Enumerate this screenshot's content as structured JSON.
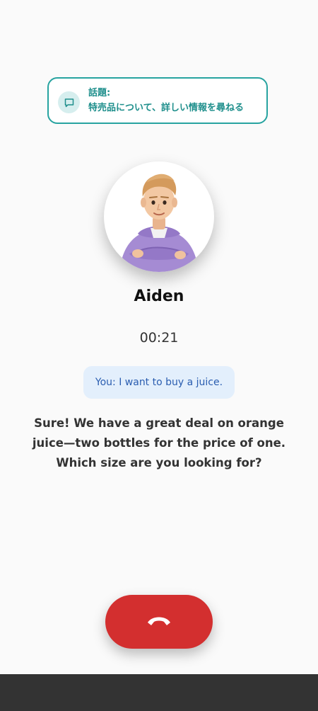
{
  "topic": {
    "label": "話題:",
    "value": "特売品について、詳しい情報を尋ねる",
    "icon": "chat-bubble-icon"
  },
  "caller": {
    "name": "Aiden",
    "timer": "00:21"
  },
  "conversation": {
    "user_message": "You: I want to buy a juice.",
    "reply": "Sure! We have a great deal on orange juice—two bottles for the price of one. Which size are you looking for?"
  },
  "controls": {
    "hangup_icon": "phone-hangup-icon"
  },
  "colors": {
    "accent": "#27a3a0",
    "hangup": "#d32f2f",
    "bubble_bg": "#e3effc",
    "bubble_text": "#2a5db0"
  }
}
